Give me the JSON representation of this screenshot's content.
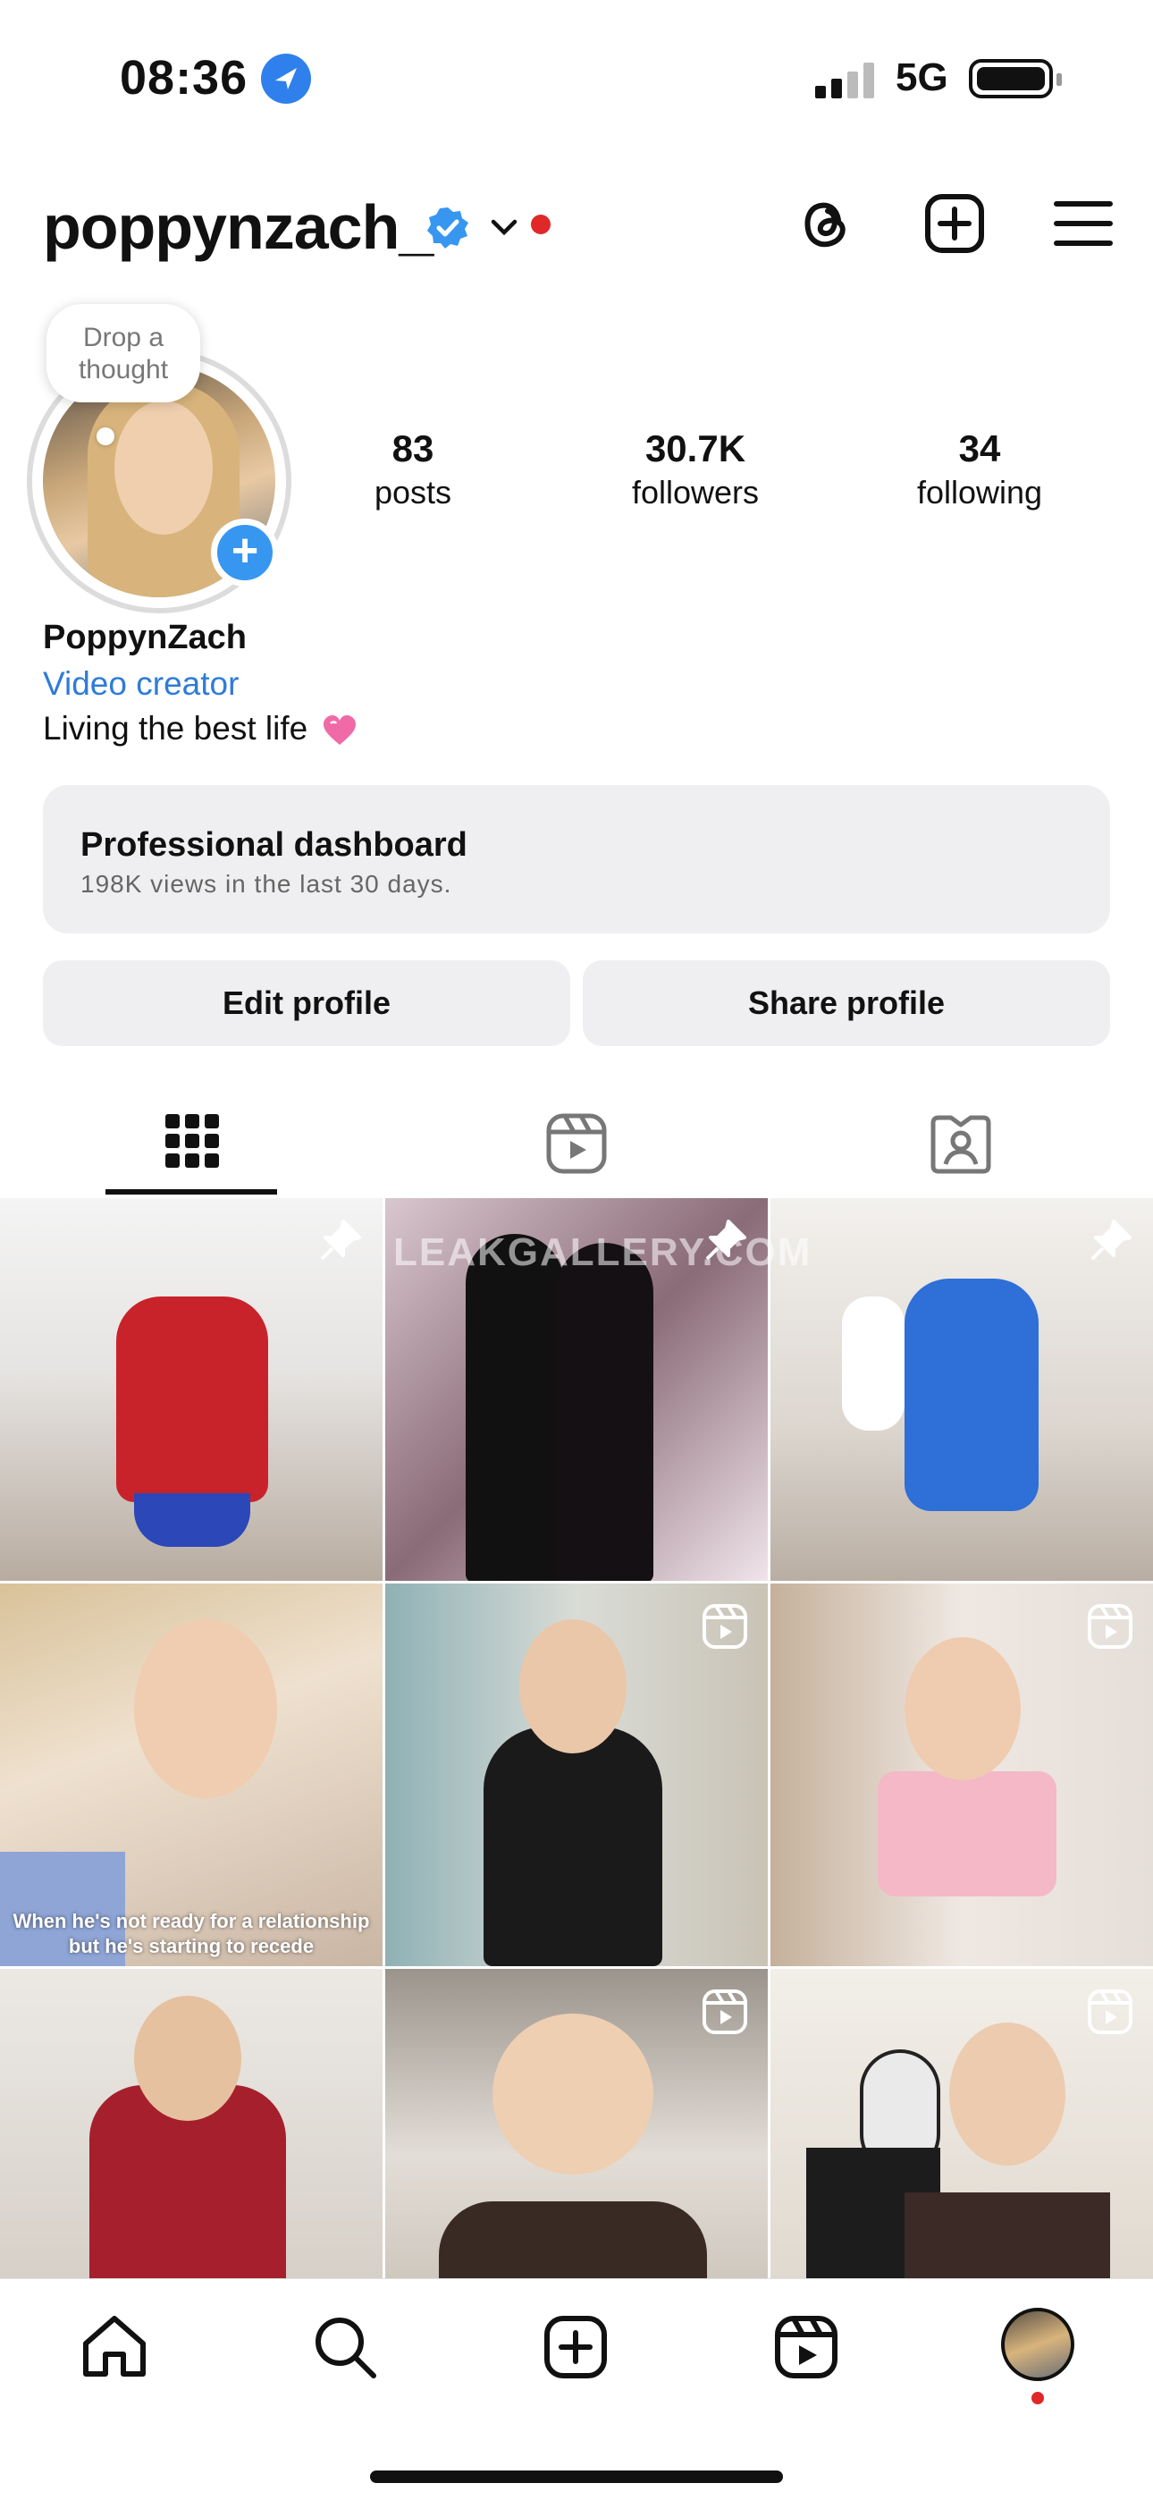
{
  "status_bar": {
    "time": "08:36",
    "network": "5G"
  },
  "header": {
    "username": "poppynzach_"
  },
  "bubble": {
    "line1": "Drop a",
    "line2": "thought"
  },
  "stats": [
    {
      "value": "83",
      "label": "posts"
    },
    {
      "value": "30.7K",
      "label": "followers"
    },
    {
      "value": "34",
      "label": "following"
    }
  ],
  "bio": {
    "name": "PoppynZach",
    "category": "Video creator",
    "text": "Living the best life"
  },
  "dashboard": {
    "title": "Professional dashboard",
    "subtitle": "198K views in the last 30 days."
  },
  "buttons": {
    "edit": "Edit profile",
    "share": "Share profile"
  },
  "tabs": [
    {
      "icon": "grid-icon"
    },
    {
      "icon": "reels-icon"
    },
    {
      "icon": "tagged-icon"
    }
  ],
  "grid": {
    "watermark": "LEAKGALLERY.COM",
    "caption": "When he's not ready for a relationship but he's starting to recede",
    "posts": [
      {
        "overlay": "pin-icon"
      },
      {
        "overlay": "pin-icon"
      },
      {
        "overlay": "pin-icon"
      },
      {
        "overlay": "none"
      },
      {
        "overlay": "reel-icon"
      },
      {
        "overlay": "reel-icon"
      },
      {
        "overlay": "none"
      },
      {
        "overlay": "reel-icon"
      },
      {
        "overlay": "reel-icon"
      }
    ]
  },
  "nav": [
    {
      "icon": "home-icon"
    },
    {
      "icon": "search-icon"
    },
    {
      "icon": "create-icon"
    },
    {
      "icon": "reels-icon"
    },
    {
      "icon": "profile-avatar"
    }
  ],
  "colors": {
    "accent": "#3797f0",
    "link": "#2f7bd8",
    "notification": "#e02828",
    "surface": "#efeff1"
  }
}
